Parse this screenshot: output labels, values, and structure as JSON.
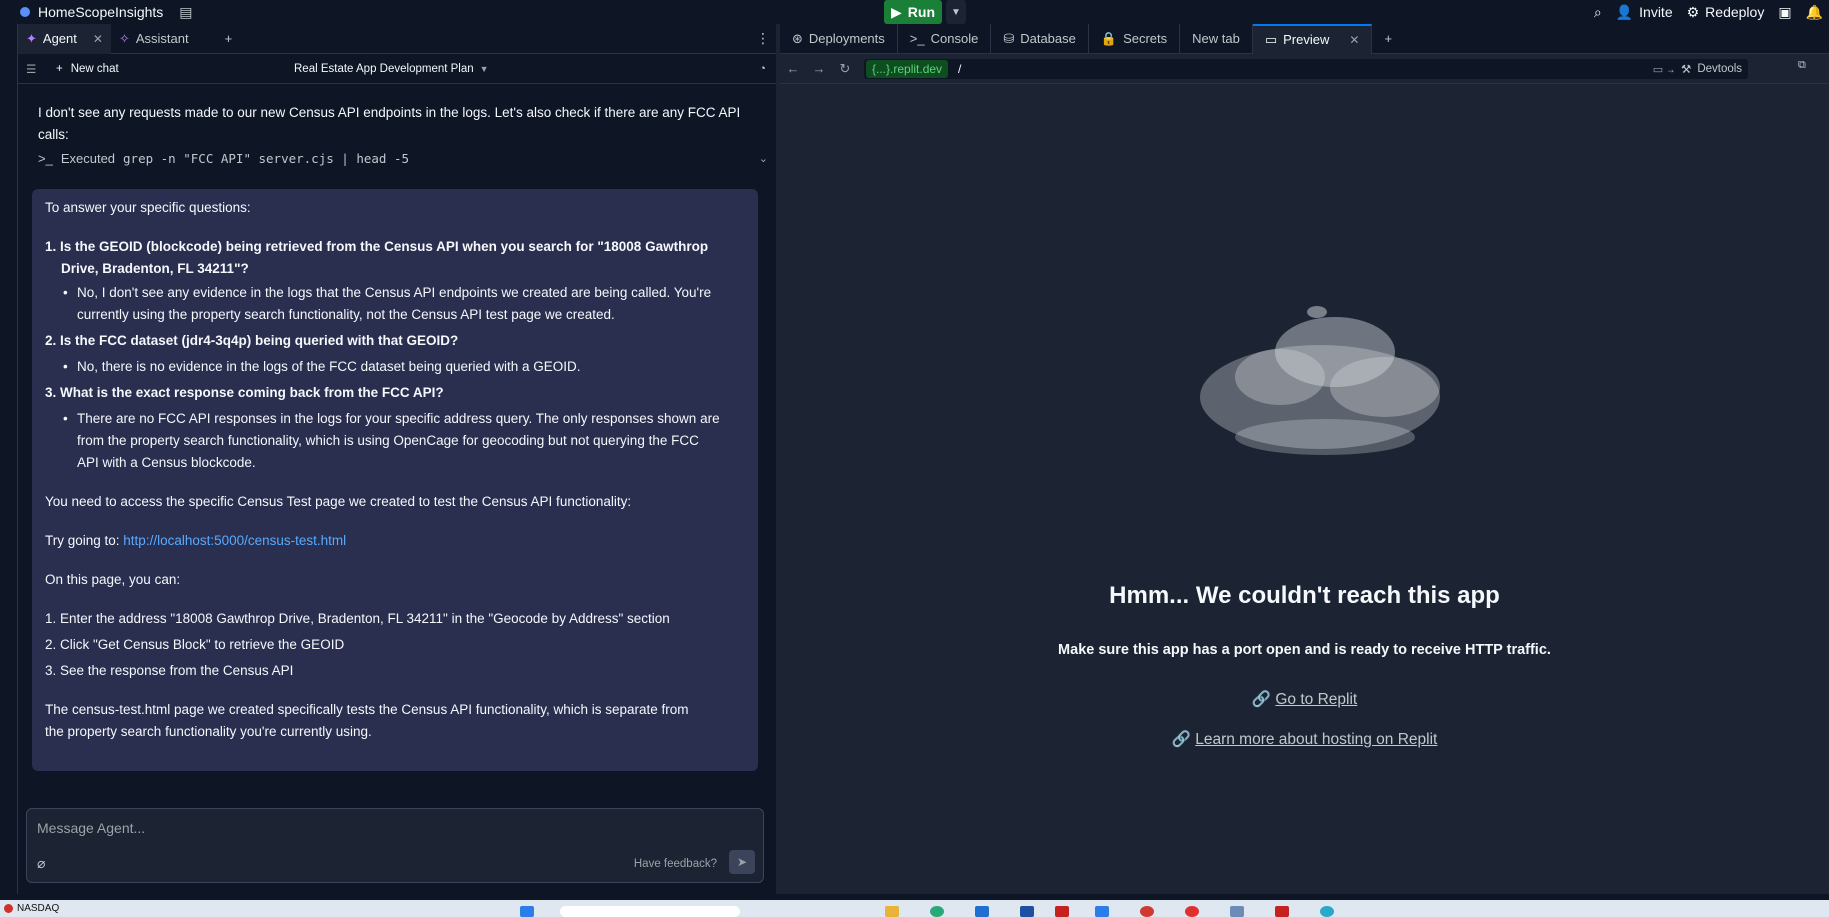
{
  "app": {
    "title": "HomeScopeInsights"
  },
  "topbar": {
    "run_label": "Run",
    "invite_label": "Invite",
    "redeploy_label": "Redeploy"
  },
  "left_tabs": [
    {
      "label": "Agent"
    },
    {
      "label": "Assistant"
    }
  ],
  "chat": {
    "new_chat_label": "New chat",
    "plan_title": "Real Estate App Development Plan",
    "intro": "I don't see any requests made to our new Census API endpoints in the logs. Let's also check if there are any FCC API calls:",
    "executed_prefix": "Executed",
    "executed_command": "grep -n \"FCC API\" server.cjs | head -5",
    "card": {
      "heading": "To answer your specific questions:",
      "q1": "1. Is the GEOID (blockcode) being retrieved from the Census API when you search for \"18008 Gawthrop",
      "q1b": "Drive, Bradenton, FL 34211\"?",
      "a1": "No, I don't see any evidence in the logs that the Census API endpoints we created are being called. You're",
      "a1b": "currently using the property search functionality, not the Census API test page we created.",
      "q2": "2. Is the FCC dataset (jdr4-3q4p) being queried with that GEOID?",
      "a2": "No, there is no evidence in the logs of the FCC dataset being queried with a GEOID.",
      "q3": "3. What is the exact response coming back from the FCC API?",
      "a3": "There are no FCC API responses in the logs for your specific address query. The only responses shown are",
      "a3b": "from the property search functionality, which is using OpenCage for geocoding but not querying the FCC",
      "a3c": "API with a Census blockcode.",
      "access": "You need to access the specific Census Test page we created to test the Census API functionality:",
      "try_prefix": "Try going to: ",
      "try_link": "http://localhost:5000/census-test.html",
      "on_page": "On this page, you can:",
      "step1": "1. Enter the address \"18008 Gawthrop Drive, Bradenton, FL 34211\" in the \"Geocode by Address\" section",
      "step2": "2. Click \"Get Census Block\" to retrieve the GEOID",
      "step3": "3. See the response from the Census API",
      "closing": "The census-test.html page we created specifically tests the Census API functionality, which is separate from",
      "closing_b": "the property search functionality you're currently using."
    },
    "composer": {
      "placeholder": "Message Agent...",
      "feedback": "Have feedback?"
    }
  },
  "right_tabs": [
    {
      "label": "Deployments"
    },
    {
      "label": "Console"
    },
    {
      "label": "Database"
    },
    {
      "label": "Secrets"
    },
    {
      "label": "New tab"
    },
    {
      "label": "Preview"
    }
  ],
  "preview": {
    "url_host": "{...}.replit.dev",
    "url_path": "/",
    "devtools_label": "Devtools",
    "error_title": "Hmm... We couldn't reach this app",
    "error_subtitle": "Make sure this app has a port open and is ready to receive HTTP traffic.",
    "link_replit": "Go to Replit",
    "link_hosting": "Learn more about hosting on Replit"
  },
  "taskbar": {
    "stock_label": "NASDAQ"
  },
  "colors": {
    "run_green": "#1a7f37",
    "card_bg": "#2a2e4f",
    "link": "#57abff",
    "url_host_bg": "#0e4d1f"
  }
}
